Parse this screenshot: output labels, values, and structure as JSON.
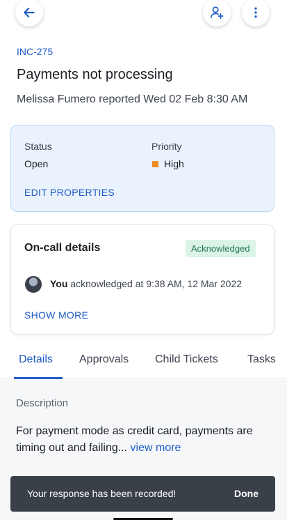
{
  "header": {
    "back_icon": "arrow-left-icon",
    "assign_icon": "person-add-icon",
    "more_icon": "vertical-dots-icon"
  },
  "ticket": {
    "id": "INC-275",
    "title": "Payments not processing",
    "reporter_line": "Melissa Fumero reported Wed 02 Feb 8:30 AM"
  },
  "properties": {
    "status_label": "Status",
    "status_value": "Open",
    "priority_label": "Priority",
    "priority_value": "High",
    "priority_color": "#f08a24",
    "edit_label": "EDIT PROPERTIES"
  },
  "oncall": {
    "title": "On-call details",
    "badge": "Acknowledged",
    "actor": "You",
    "ack_text": "acknowledged at 9:38 AM, 12 Mar 2022",
    "show_more": "SHOW MORE"
  },
  "tabs": [
    {
      "label": "Details",
      "active": true
    },
    {
      "label": "Approvals"
    },
    {
      "label": "Child Tickets"
    },
    {
      "label": "Tasks"
    }
  ],
  "details": {
    "description_label": "Description",
    "description_text": "For payment mode as credit card, payments are timing out and failing...",
    "view_more": "view more"
  },
  "toast": {
    "message": "Your response has been recorded!",
    "action": "Done"
  },
  "colors": {
    "accent": "#1f5bc6",
    "badge_bg": "#dcf3e8",
    "badge_text": "#1e7a4c",
    "toast_bg": "#3a4047"
  }
}
